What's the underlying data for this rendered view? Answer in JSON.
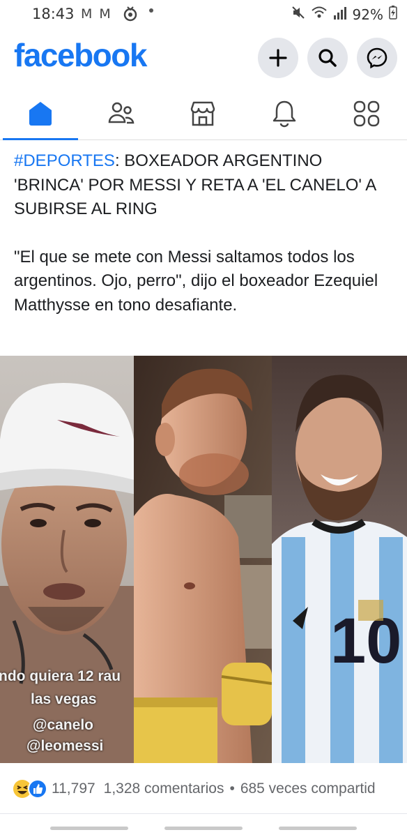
{
  "status_bar": {
    "time": "18:43",
    "left_icons": "M M",
    "battery": "92%"
  },
  "header": {
    "logo": "facebook",
    "brand_color": "#1877f2",
    "buttons": [
      "plus-icon",
      "search-icon",
      "messenger-icon"
    ]
  },
  "nav": {
    "tabs": [
      "home-icon",
      "friends-icon",
      "marketplace-icon",
      "notifications-icon",
      "menu-icon"
    ],
    "active": "home-icon"
  },
  "post": {
    "hashtag": "#DEPORTES",
    "headline_rest": ": BOXEADOR ARGENTINO 'BRINCA' POR MESSI Y RETA A 'EL CANELO' A SUBIRSE AL RING",
    "quote": "\"El que se mete con Messi saltamos todos los argentinos. Ojo, perro\", dijo el boxeador Ezequiel Matthysse en tono desafiante.",
    "image_overlay": [
      "ndo quiera 12 rau",
      "las vegas",
      "@canelo",
      "@leomessi"
    ]
  },
  "engagement": {
    "reaction_count": "11,797",
    "comments": "1,328 comentarios",
    "separator": "•",
    "shares": "685 veces compartid"
  }
}
